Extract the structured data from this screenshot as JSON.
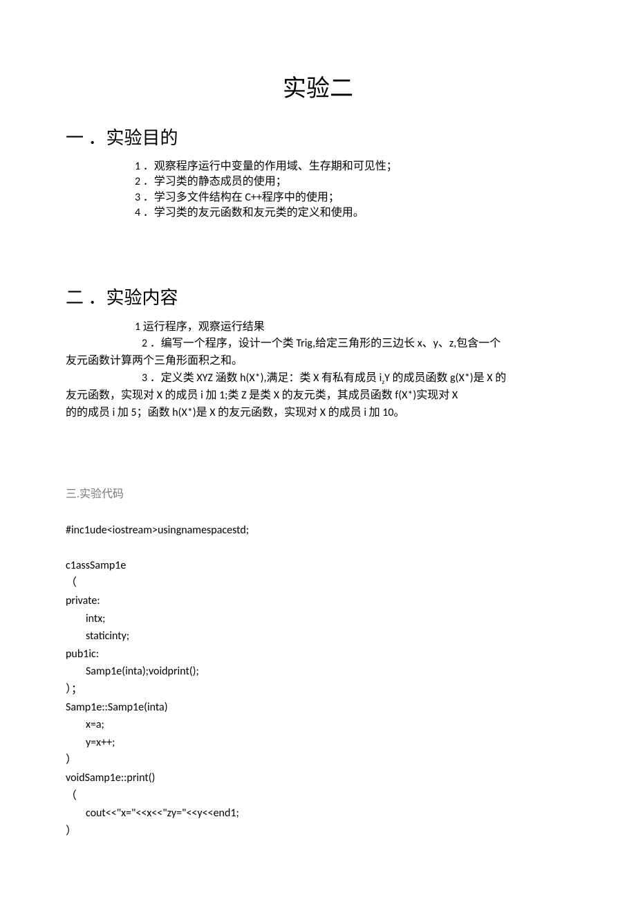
{
  "title": "实验二",
  "s1": {
    "heading": "一 ．实验目的",
    "items": [
      "1 ．观察程序运行中变量的作用域、生存期和可见性；",
      "2 ．学习类的静态成员的使用；",
      "3 ．学习多文件结构在 C++程序中的使用；",
      "4 ．学习类的友元函数和友元类的定义和使用。"
    ]
  },
  "s2": {
    "heading": "二 ．实验内容",
    "p1": "1 运行程序，观察运行结果",
    "p2a": "2 ．编写一个程序，设计一个类 Trig,给定三角形的三边长 x、y、z,包含一个",
    "p2b": "友元函数计算两个三角形面积之和。",
    "p3a_pre": "3 ．定义类 XYZ 涵数 h(X*),满足：类 X 有私有成员 i",
    "p3a_sub": "z",
    "p3a_post": "Y 的成员函数 g(X*)是 X 的",
    "p3b": "友元函数，实现对 X 的成员 i 加 1;类 Z 是类 X 的友元类，其成员函数 f(X*)实现对 X",
    "p3c": "的的成员 i 加 5；函数 h(X*)是 X 的友元函数，实现对 X 的成员 i 加 10。"
  },
  "s3": {
    "heading": "三.实验代码",
    "code": "#inc1ude<iostream>usingnamespacestd;\n\nc1assSamp1e\n（\nprivate:\n        intx;\n        staticinty;\npub1ic:\n        Samp1e(inta);voidprint();\n）；\nSamp1e::Samp1e(inta)\n        x=a;\n        y=x++;\n）\nvoidSamp1e::print()\n（\n        cout<<\"x=\"<<x<<\"zy=\"<<y<<end1;\n）"
  }
}
